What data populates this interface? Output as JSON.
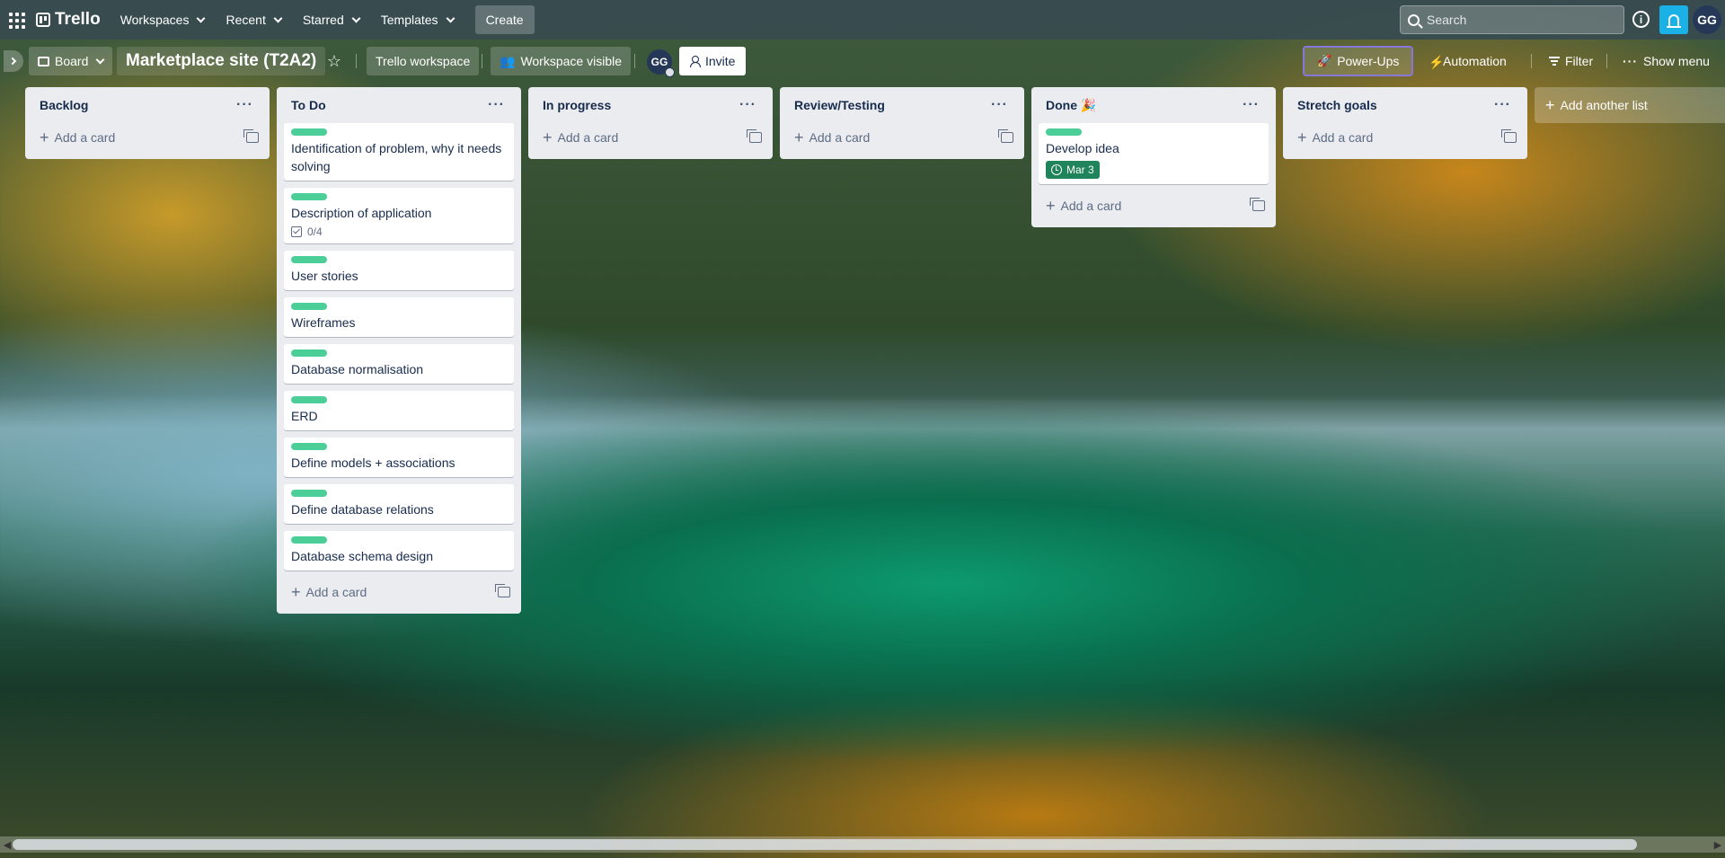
{
  "topbar": {
    "logo_text": "Trello",
    "nav": [
      "Workspaces",
      "Recent",
      "Starred",
      "Templates"
    ],
    "create_label": "Create",
    "search_placeholder": "Search",
    "info_glyph": "i",
    "avatar_initials": "GG"
  },
  "board_header": {
    "view_label": "Board",
    "title": "Marketplace site (T2A2)",
    "workspace_label": "Trello workspace",
    "visibility_label": "Workspace visible",
    "member_initials": "GG",
    "invite_label": "Invite",
    "powerups_label": "Power-Ups",
    "automation_label": "Automation",
    "filter_label": "Filter",
    "menu_label": "Show menu"
  },
  "lists": [
    {
      "title": "Backlog",
      "cards": [],
      "add_label": "Add a card"
    },
    {
      "title": "To Do",
      "add_label": "Add a card",
      "cards": [
        {
          "title": "Identification of problem, why it needs solving"
        },
        {
          "title": "Description of application",
          "checklist": "0/4"
        },
        {
          "title": "User stories"
        },
        {
          "title": "Wireframes"
        },
        {
          "title": "Database normalisation"
        },
        {
          "title": "ERD"
        },
        {
          "title": "Define models + associations"
        },
        {
          "title": "Define database relations"
        },
        {
          "title": "Database schema design"
        }
      ]
    },
    {
      "title": "In progress",
      "cards": [],
      "add_label": "Add a card"
    },
    {
      "title": "Review/Testing",
      "cards": [],
      "add_label": "Add a card"
    },
    {
      "title": "Done 🎉",
      "add_label": "Add a card",
      "cards": [
        {
          "title": "Develop idea",
          "due": "Mar 3"
        }
      ]
    },
    {
      "title": "Stretch goals",
      "cards": [],
      "add_label": "Add a card"
    }
  ],
  "add_list_label": "Add another list",
  "colors": {
    "label_green": "#4bce97",
    "due_green": "#1f845a",
    "notification_blue": "#1ab2e6",
    "powerups_border": "#8777d9"
  },
  "icons": [
    "apps-grid-icon",
    "trello-logo-icon",
    "search-icon",
    "info-icon",
    "bell-icon",
    "star-icon",
    "board-view-icon",
    "people-icon",
    "person-add-icon",
    "rocket-icon",
    "bolt-icon",
    "filter-icon",
    "more-icon",
    "checklist-icon",
    "clock-icon",
    "card-template-icon",
    "plus-icon"
  ]
}
